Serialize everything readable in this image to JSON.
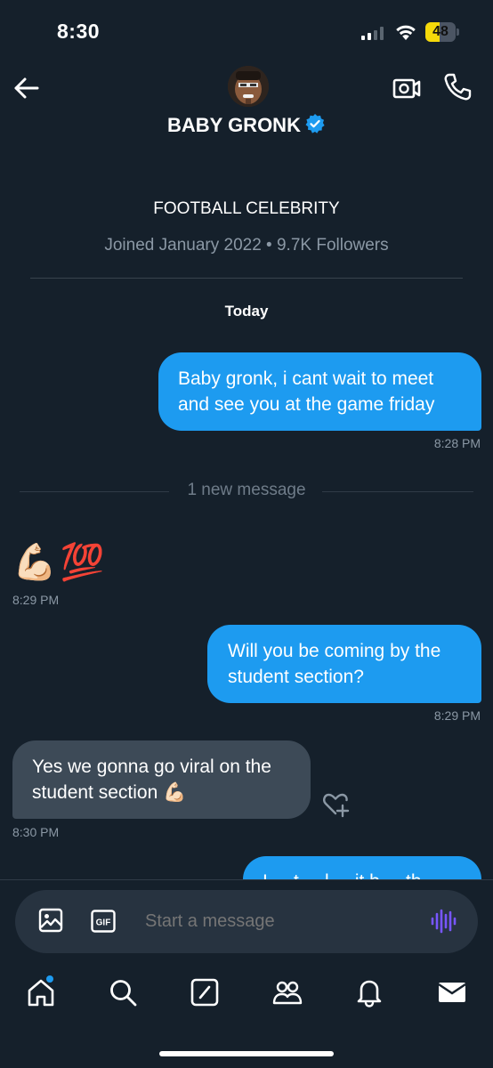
{
  "status_bar": {
    "time": "8:30",
    "battery": "48",
    "battery_level": 0.48
  },
  "header": {
    "name": "BABY GRONK",
    "verified": true,
    "bio": "FOOTBALL CELEBRITY",
    "meta": "Joined January 2022 • 9.7K Followers",
    "icons": [
      "back-arrow-icon",
      "video-call-icon",
      "phone-icon",
      "verified-badge-icon"
    ]
  },
  "conversation": {
    "date_label": "Today",
    "new_message_label": "1 new message",
    "messages": [
      {
        "direction": "out",
        "lines": [
          "Baby gronk, i cant wait to meet",
          "and see you at the game friday"
        ],
        "time": "8:28 PM"
      },
      {
        "direction": "in",
        "emoji": [
          "💪🏻",
          "💯"
        ],
        "time": "8:29 PM"
      },
      {
        "direction": "out",
        "lines": [
          "Will you be coming by the",
          "student section?"
        ],
        "time": "8:29 PM"
      },
      {
        "direction": "in",
        "lines": [
          "Yes we gonna go viral on the",
          "student section 💪🏻"
        ],
        "time": "8:30 PM"
      },
      {
        "direction": "out",
        "lines": [
          "I ... t ... l ... it b ... th ..."
        ],
        "time": ""
      }
    ]
  },
  "composer": {
    "placeholder": "Start a message",
    "gif_label": "GIF"
  },
  "nav": {
    "items": [
      "home-icon",
      "search-icon",
      "compose-icon",
      "communities-icon",
      "notifications-icon",
      "messages-icon"
    ],
    "accent": "#1d9bf0"
  },
  "colors": {
    "background": "#15202b",
    "outgoing_bubble": "#1d9bf0",
    "incoming_bubble": "#3d4a57",
    "muted_text": "#8b98a5",
    "voice_accent": "#7856ff"
  }
}
